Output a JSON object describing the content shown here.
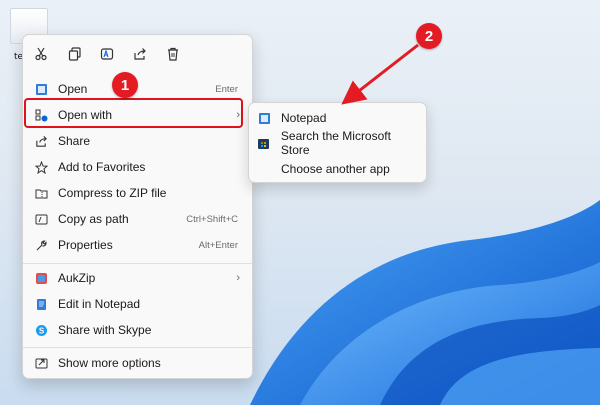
{
  "desktop": {
    "icon_label": "te"
  },
  "menu": {
    "toolbar": [
      "cut-icon",
      "copy-icon",
      "rename-icon",
      "share-icon",
      "delete-icon"
    ],
    "items": [
      {
        "label": "Open",
        "shortcut": "Enter"
      },
      {
        "label": "Open with",
        "shortcut": ""
      },
      {
        "label": "Share",
        "shortcut": ""
      },
      {
        "label": "Add to Favorites",
        "shortcut": ""
      },
      {
        "label": "Compress to ZIP file",
        "shortcut": ""
      },
      {
        "label": "Copy as path",
        "shortcut": "Ctrl+Shift+C"
      },
      {
        "label": "Properties",
        "shortcut": "Alt+Enter"
      },
      {
        "label": "AukZip",
        "shortcut": ""
      },
      {
        "label": "Edit in Notepad",
        "shortcut": ""
      },
      {
        "label": "Share with Skype",
        "shortcut": ""
      },
      {
        "label": "Show more options",
        "shortcut": ""
      }
    ]
  },
  "submenu": {
    "items": [
      {
        "label": "Notepad"
      },
      {
        "label": "Search the Microsoft Store"
      },
      {
        "label": "Choose another app"
      }
    ]
  },
  "annotations": {
    "step1": "1",
    "step2": "2"
  },
  "colors": {
    "annotation_red": "#e41b23",
    "menu_bg": "#f9f9f9",
    "accent_blue": "#0a64d8"
  }
}
